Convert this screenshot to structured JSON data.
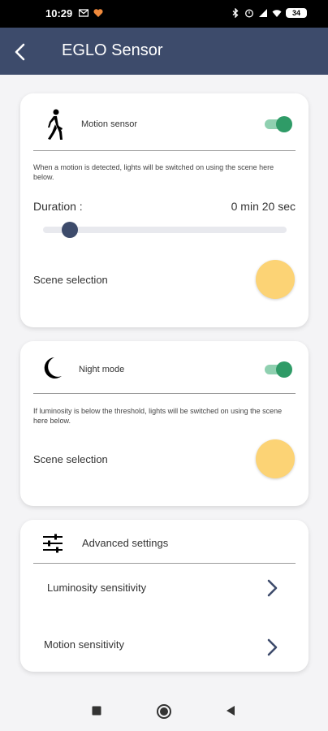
{
  "status_bar": {
    "time": "10:29",
    "battery": "34"
  },
  "app_bar": {
    "title": "EGLO Sensor",
    "back_icon": "back-arrow-icon"
  },
  "motion_card": {
    "icon": "walking-person-icon",
    "label": "Motion sensor",
    "enabled": true,
    "description": "When a motion is detected, lights will be switched on using the scene here below.",
    "duration_label": "Duration :",
    "duration_value": "0 min 20 sec",
    "duration_fraction": 0.11,
    "scene_label": "Scene selection",
    "scene_color": "#fcd375"
  },
  "night_card": {
    "icon": "crescent-moon-icon",
    "label": "Night mode",
    "enabled": true,
    "description": "If luminosity is below the threshold, lights will be switched on using the scene here below.",
    "scene_label": "Scene selection",
    "scene_color": "#fcd375"
  },
  "advanced_card": {
    "icon": "sliders-icon",
    "title": "Advanced settings",
    "items": [
      {
        "label": "Luminosity sensitivity"
      },
      {
        "label": "Motion sensitivity"
      }
    ]
  },
  "colors": {
    "app_bar": "#3d4b6b",
    "toggle_on": "#2f9b67",
    "slider_thumb": "#3d4b6b"
  }
}
